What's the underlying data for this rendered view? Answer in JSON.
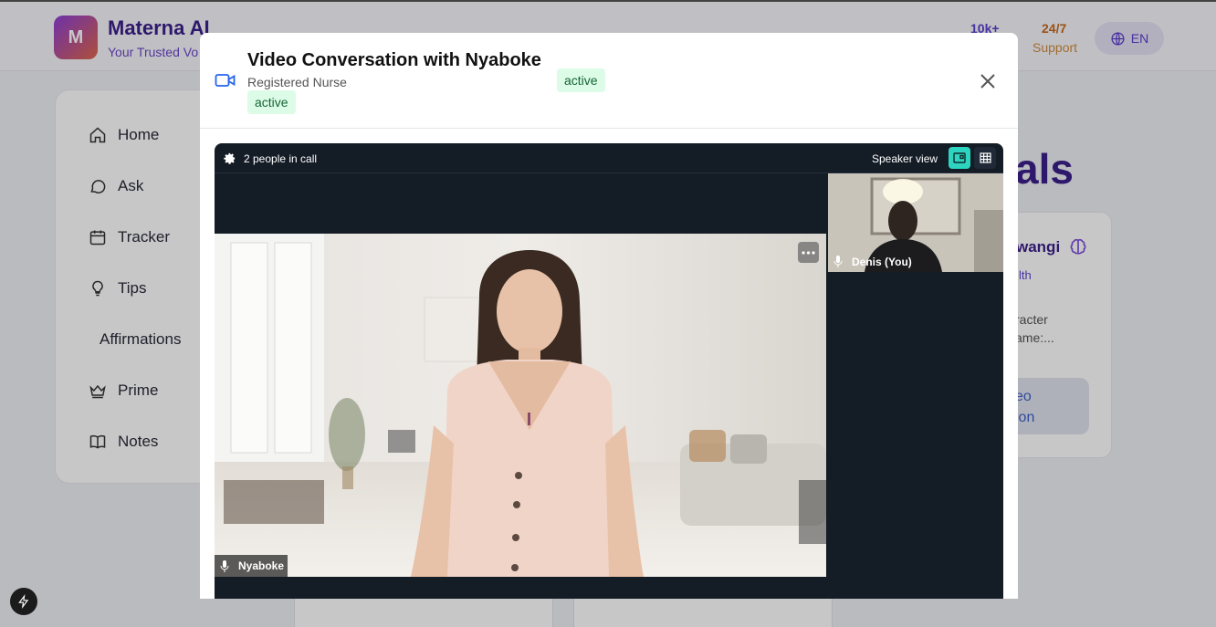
{
  "app": {
    "logo_letter": "M",
    "brand_title": "Materna AI",
    "brand_subtitle": "Your Trusted Voice",
    "stat_users": "10k+",
    "stat_support_value": "24/7",
    "stat_support_label": "Support",
    "language": "EN"
  },
  "sidebar": {
    "items": [
      {
        "label": "Home",
        "icon": "home-icon"
      },
      {
        "label": "Ask",
        "icon": "chat-bubble-icon"
      },
      {
        "label": "Tracker",
        "icon": "calendar-icon"
      },
      {
        "label": "Tips",
        "icon": "lightbulb-icon"
      },
      {
        "label": "Affirmations",
        "icon": ""
      },
      {
        "label": "Prime",
        "icon": "crown-icon"
      },
      {
        "label": "Notes",
        "icon": "book-icon"
      }
    ]
  },
  "background": {
    "heading_fragment": "als",
    "card_name_fragment": "wangi",
    "card_category_fragment": "lth",
    "card_desc_line1": "racter",
    "card_desc_line2": "ame:...",
    "card_button_line1": "eo",
    "card_button_line2": "ion"
  },
  "modal": {
    "title": "Video Conversation with Nyaboke",
    "role": "Registered Nurse",
    "status_badge": "active",
    "status_badge_2": "active"
  },
  "call": {
    "people_count": "2 people in call",
    "view_mode_label": "Speaker view",
    "main_participant": "Nyaboke",
    "self_participant": "Denis (You)"
  },
  "colors": {
    "accent_purple": "#3c1f8a",
    "badge_green_bg": "#dcfce7",
    "badge_green_text": "#166534",
    "call_bg": "#141c26",
    "speaker_toggle": "#2dd4bf"
  }
}
